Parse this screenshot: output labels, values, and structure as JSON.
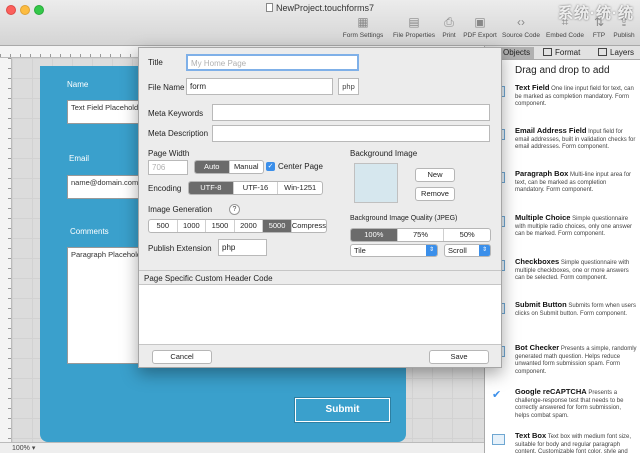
{
  "window": {
    "title": "NewProject.touchforms7",
    "watermark": "系统·统·统"
  },
  "toolbar": [
    {
      "label": "Form Settings",
      "icon": "form-settings-icon"
    },
    {
      "label": "File Properties",
      "icon": "file-properties-icon"
    },
    {
      "label": "Print",
      "icon": "print-icon"
    },
    {
      "label": "PDF Export",
      "icon": "pdf-export-icon"
    },
    {
      "label": "Source Code",
      "icon": "source-code-icon"
    },
    {
      "label": "Embed Code",
      "icon": "embed-code-icon"
    },
    {
      "label": "FTP",
      "icon": "ftp-icon"
    },
    {
      "label": "Publish",
      "icon": "publish-icon"
    }
  ],
  "canvas": {
    "name_label": "Name",
    "name_value": "Text Field Placeholde",
    "email_label": "Email",
    "email_value": "name@domain.com",
    "comments_label": "Comments",
    "comments_value": "Paragraph Placeholde",
    "submit_label": "Submit",
    "zoom": "100%"
  },
  "right_panel": {
    "tabs": {
      "objects": "Objects",
      "format": "Format",
      "layers": "Layers"
    },
    "heading": "Drag and drop to add",
    "widgets": [
      {
        "name": "Text Field",
        "desc": "One line input field for text, can be marked as completion mandatory.  Form component."
      },
      {
        "name": "Email Address Field",
        "desc": "Input field for email addresses, built in validation checks for email addresses.  Form component."
      },
      {
        "name": "Paragraph Box",
        "desc": "Multi-line input area for text, can be marked as completion mandatory.  Form component."
      },
      {
        "name": "Multiple Choice",
        "desc": "Simple questionnaire with multiple radio choices, only one answer can be marked.  Form component."
      },
      {
        "name": "Checkboxes",
        "desc": "Simple questionnaire with multiple checkboxes, one or more answers can be selected.  Form component."
      },
      {
        "name": "Submit Button",
        "desc": "Submits form when users clicks on Submit button.  Form component."
      },
      {
        "name": "Bot Checker",
        "desc": "Presents a simple, randomly generated math question.  Helps reduce unwanted form submission spam.  Form component."
      },
      {
        "name": "Google reCAPTCHA",
        "desc": "Presents a challenge-response test that needs to be correctly answered for form submission, helps combat spam."
      },
      {
        "name": "Text Box",
        "desc": "Text box with medium font size, suitable for body and regular paragraph content. Customizable font color, style and"
      }
    ]
  },
  "dialog": {
    "title_label": "Title",
    "title_placeholder": "My Home Page",
    "file_name_label": "File Name",
    "file_name_value": "form",
    "file_ext": "php",
    "meta_keywords_label": "Meta Keywords",
    "meta_description_label": "Meta Description",
    "page_width_label": "Page Width",
    "page_width_value": "706",
    "page_width_auto": "Auto",
    "page_width_manual": "Manual",
    "center_page_label": "Center Page",
    "encoding_label": "Encoding",
    "encoding_options": [
      "UTF-8",
      "UTF-16",
      "Win-1251"
    ],
    "encoding_selected": "UTF-8",
    "image_generation_label": "Image Generation",
    "help": "?",
    "image_sizes": [
      "500",
      "1000",
      "1500",
      "2000",
      "5000",
      "Compress"
    ],
    "image_size_selected": "5000",
    "publish_extension_label": "Publish Extension",
    "publish_extension_value": "php",
    "background_image_label": "Background Image",
    "new_button": "New",
    "remove_button": "Remove",
    "bg_quality_label": "Background Image Quality (JPEG)",
    "bg_quality_options": [
      "100%",
      "75%",
      "50%"
    ],
    "bg_quality_selected": "100%",
    "tile_select": "Tile",
    "scroll_select": "Scroll",
    "header_code_label": "Page Specific Custom Header Code",
    "cancel_button": "Cancel",
    "save_button": "Save"
  }
}
